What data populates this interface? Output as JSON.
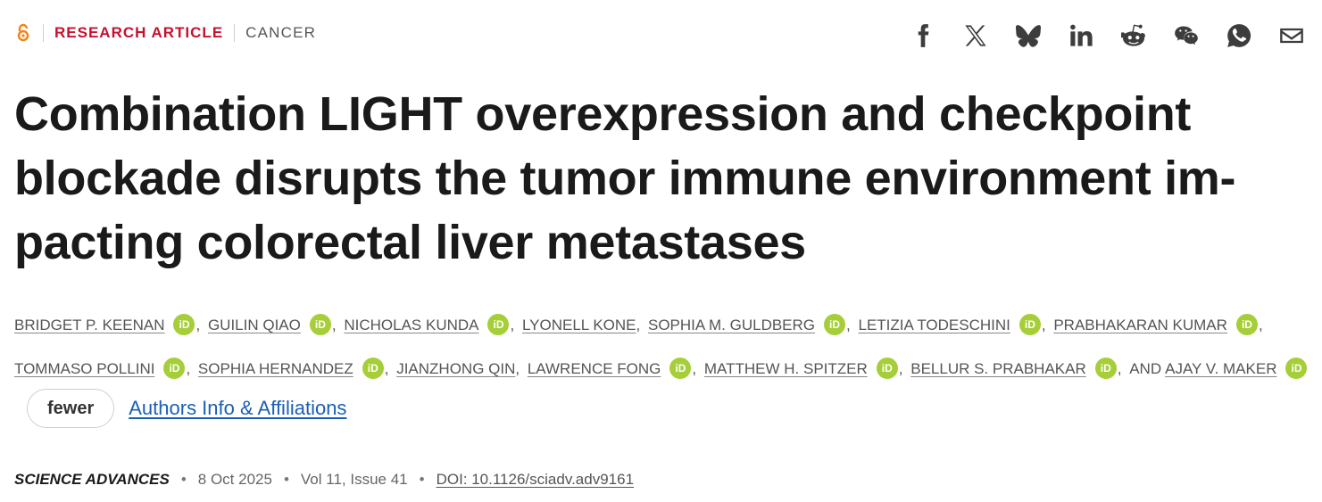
{
  "header": {
    "open_access_icon": "open-access-icon",
    "article_type": "RESEARCH ARTICLE",
    "subject": "CANCER"
  },
  "share": [
    {
      "name": "facebook-icon"
    },
    {
      "name": "x-icon"
    },
    {
      "name": "bluesky-icon"
    },
    {
      "name": "linkedin-icon"
    },
    {
      "name": "reddit-icon"
    },
    {
      "name": "wechat-icon"
    },
    {
      "name": "whatsapp-icon"
    },
    {
      "name": "email-icon"
    }
  ],
  "title": {
    "line1": "Combination LIGHT overexpression and checkpoint",
    "line2": "blockade disrupts the tumor immune environment im-",
    "line3": "pacting colorectal liver metastases"
  },
  "authors": [
    {
      "name": "BRIDGET P. KEENAN",
      "orcid": true
    },
    {
      "name": "GUILIN QIAO",
      "orcid": true
    },
    {
      "name": "NICHOLAS KUNDA",
      "orcid": true
    },
    {
      "name": "LYONELL KONE",
      "orcid": false
    },
    {
      "name": "SOPHIA M. GULDBERG",
      "orcid": true
    },
    {
      "name": "LETIZIA TODESCHINI",
      "orcid": true
    },
    {
      "name": "PRABHAKARAN KUMAR",
      "orcid": true
    },
    {
      "name": "TOMMASO POLLINI",
      "orcid": true
    },
    {
      "name": "SOPHIA HERNANDEZ",
      "orcid": true
    },
    {
      "name": "JIANZHONG QIN",
      "orcid": false
    },
    {
      "name": "LAWRENCE FONG",
      "orcid": true
    },
    {
      "name": "MATTHEW H. SPITZER",
      "orcid": true
    },
    {
      "name": "BELLUR S. PRABHAKAR",
      "orcid": true
    },
    {
      "name": "AJAY V. MAKER",
      "orcid": true
    }
  ],
  "labels": {
    "orcid": "iD",
    "comma": ",",
    "and": "AND"
  },
  "actions": {
    "fewer_label": "fewer",
    "affiliations_label": "Authors Info & Affiliations"
  },
  "meta": {
    "journal": "SCIENCE ADVANCES",
    "date": "8 Oct 2025",
    "volume_issue": "Vol 11, Issue 41",
    "doi": "DOI: 10.1126/sciadv.adv9161",
    "separator": "•"
  },
  "colors": {
    "article_type": "#c8102e",
    "orcid": "#a6ce39",
    "link": "#1a5fb4",
    "open_access": "#f68212"
  }
}
